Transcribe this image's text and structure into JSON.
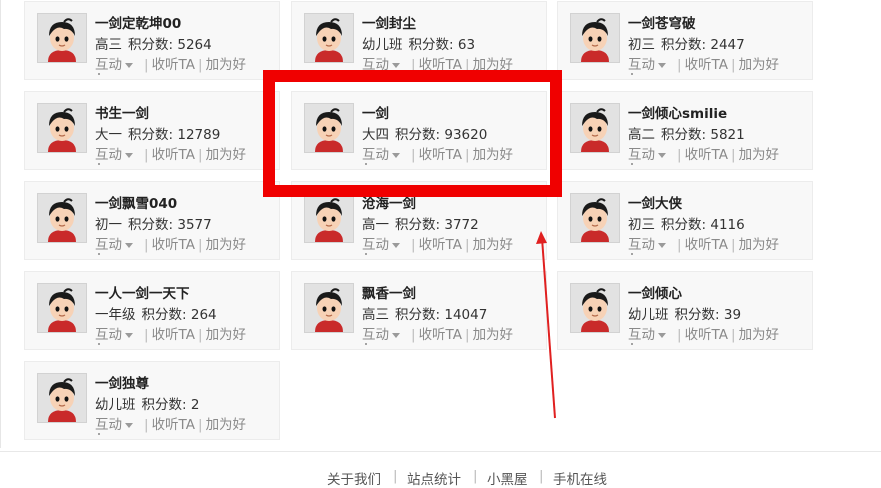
{
  "cards": [
    {
      "name": "一剑定乾坤00",
      "grade": "高三",
      "score_label": "积分数:",
      "score": "5264"
    },
    {
      "name": "一剑封尘",
      "grade": "幼儿班",
      "score_label": "积分数:",
      "score": "63"
    },
    {
      "name": "一剑苍穹破",
      "grade": "初三",
      "score_label": "积分数:",
      "score": "2447"
    },
    {
      "name": "书生一剑",
      "grade": "大一",
      "score_label": "积分数:",
      "score": "12789"
    },
    {
      "name": "一剑",
      "grade": "大四",
      "score_label": "积分数:",
      "score": "93620"
    },
    {
      "name": "一剑倾心smilie",
      "grade": "高二",
      "score_label": "积分数:",
      "score": "5821"
    },
    {
      "name": "一剑飘雪040",
      "grade": "初一",
      "score_label": "积分数:",
      "score": "3577"
    },
    {
      "name": "沧海一剑",
      "grade": "高一",
      "score_label": "积分数:",
      "score": "3772"
    },
    {
      "name": "一剑大侠",
      "grade": "初三",
      "score_label": "积分数:",
      "score": "4116"
    },
    {
      "name": "一人一剑一天下",
      "grade": "一年级",
      "score_label": "积分数:",
      "score": "264"
    },
    {
      "name": "飘香一剑",
      "grade": "高三",
      "score_label": "积分数:",
      "score": "14047"
    },
    {
      "name": "一剑倾心",
      "grade": "幼儿班",
      "score_label": "积分数:",
      "score": "39"
    },
    {
      "name": "一剑独尊",
      "grade": "幼儿班",
      "score_label": "积分数:",
      "score": "2"
    }
  ],
  "actions": {
    "interact": "互动",
    "listen": "收听TA",
    "add_friend": "加为好"
  },
  "footer": {
    "about": "关于我们",
    "stats": "站点统计",
    "mini": "小黑屋",
    "mobile": "手机在线"
  },
  "annotation": {
    "box_color": "#f00000",
    "arrow_color": "#e02020"
  }
}
